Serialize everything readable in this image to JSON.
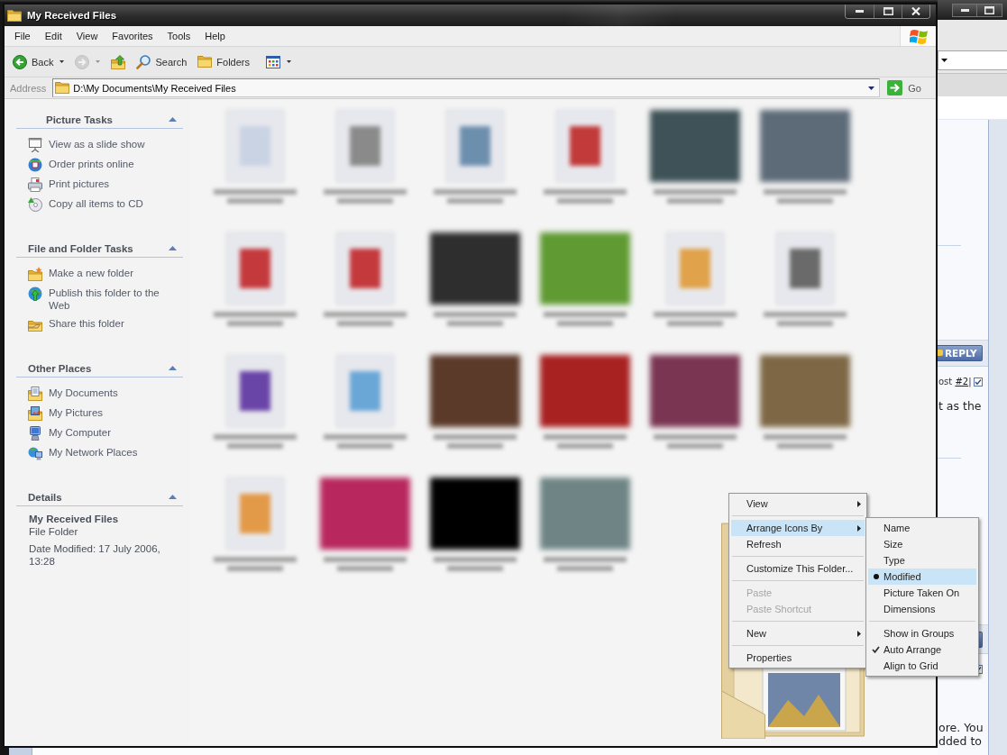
{
  "background_window": {
    "window_controls": [
      {
        "kind": "minimize"
      },
      {
        "kind": "maximize"
      }
    ]
  },
  "forum": {
    "posts": [
      {
        "reply_label": "REPLY",
        "post_text": "ost",
        "post_link": "#2",
        "post_separator": "|",
        "checked": true,
        "lines": [
          "t as the"
        ]
      },
      {
        "checked": true,
        "lines": [
          "ore. You",
          "dded to"
        ]
      }
    ]
  },
  "explorer": {
    "title": "My Received Files",
    "window_controls": [
      {
        "kind": "minimize"
      },
      {
        "kind": "maximize"
      },
      {
        "kind": "close"
      }
    ],
    "menu_bar": [
      {
        "label": "File"
      },
      {
        "label": "Edit"
      },
      {
        "label": "View"
      },
      {
        "label": "Favorites"
      },
      {
        "label": "Tools"
      },
      {
        "label": "Help"
      }
    ],
    "toolbar": [
      {
        "kind": "back",
        "label": "Back",
        "dropdown": true,
        "disabled": false
      },
      {
        "kind": "forward",
        "dropdown": true,
        "disabled": true
      },
      {
        "kind": "up",
        "dropdown": false,
        "disabled": false
      },
      {
        "kind": "search",
        "label": "Search",
        "dropdown": false,
        "disabled": false
      },
      {
        "kind": "folders",
        "label": "Folders",
        "dropdown": false,
        "disabled": false
      },
      {
        "kind": "views",
        "dropdown": true,
        "disabled": false
      }
    ],
    "address": {
      "label": "Address",
      "value": "D:\\My Documents\\My Received Files",
      "go_label": "Go"
    },
    "task_panes": [
      {
        "title": "Picture Tasks",
        "kind": "special",
        "expanded": true,
        "items": [
          {
            "kind": "slideshow",
            "label": "View as a slide show"
          },
          {
            "kind": "prints",
            "label": "Order prints online"
          },
          {
            "kind": "print",
            "label": "Print pictures"
          },
          {
            "kind": "cd",
            "label": "Copy all items to CD"
          }
        ]
      },
      {
        "title": "File and Folder Tasks",
        "kind": "normal",
        "expanded": true,
        "items": [
          {
            "kind": "new_folder",
            "label": "Make a new folder"
          },
          {
            "kind": "publish",
            "label": "Publish this folder to the Web"
          },
          {
            "kind": "share",
            "label": "Share this folder"
          }
        ]
      },
      {
        "title": "Other Places",
        "kind": "normal",
        "expanded": true,
        "items": [
          {
            "kind": "documents",
            "label": "My Documents"
          },
          {
            "kind": "pictures",
            "label": "My Pictures"
          },
          {
            "kind": "computer",
            "label": "My Computer"
          },
          {
            "kind": "network",
            "label": "My Network Places"
          }
        ]
      }
    ],
    "details": {
      "title": "Details",
      "expanded": true,
      "name": "My Received Files",
      "type": "File Folder",
      "modified": "Date Modified: 17 July 2006, 13:28"
    },
    "files": [
      {
        "kind": "document",
        "color": "#c9d3e3"
      },
      {
        "kind": "document",
        "color": "#8a8a8a"
      },
      {
        "kind": "document",
        "color": "#6d8fae"
      },
      {
        "kind": "document",
        "color": "#c23a3a"
      },
      {
        "kind": "photo",
        "color": "#3f5257"
      },
      {
        "kind": "photo",
        "color": "#5d6b78"
      },
      {
        "kind": "document",
        "color": "#c4393c"
      },
      {
        "kind": "document",
        "color": "#c4393c"
      },
      {
        "kind": "photo",
        "color": "#2e2e2e"
      },
      {
        "kind": "photo",
        "color": "#5f9a32"
      },
      {
        "kind": "document",
        "color": "#e0a24a"
      },
      {
        "kind": "document",
        "color": "#6a6a6a"
      },
      {
        "kind": "document",
        "color": "#6a45a8"
      },
      {
        "kind": "document",
        "color": "#6aa6d6"
      },
      {
        "kind": "photo",
        "color": "#5b3a2a"
      },
      {
        "kind": "photo",
        "color": "#a82222"
      },
      {
        "kind": "photo",
        "color": "#7a3552"
      },
      {
        "kind": "photo",
        "color": "#7d6745"
      },
      {
        "kind": "document",
        "color": "#e39a48"
      },
      {
        "kind": "photo",
        "color": "#b8285e"
      },
      {
        "kind": "photo",
        "color": "#000000"
      },
      {
        "kind": "photo",
        "color": "#6f8585"
      }
    ],
    "context_menu": {
      "groups": [
        [
          {
            "label": "View",
            "submenu": true,
            "highlighted": false,
            "disabled": false
          }
        ],
        [
          {
            "label": "Arrange Icons By",
            "submenu": true,
            "highlighted": true,
            "disabled": false,
            "open_submenu": {
              "groups": [
                [
                  {
                    "label": "Name",
                    "kind": "radio",
                    "checked": false,
                    "highlighted": false
                  },
                  {
                    "label": "Size",
                    "kind": "radio",
                    "checked": false,
                    "highlighted": false
                  },
                  {
                    "label": "Type",
                    "kind": "radio",
                    "checked": false,
                    "highlighted": false
                  },
                  {
                    "label": "Modified",
                    "kind": "radio",
                    "checked": true,
                    "highlighted": true
                  },
                  {
                    "label": "Picture Taken On",
                    "kind": "radio",
                    "checked": false,
                    "highlighted": false
                  },
                  {
                    "label": "Dimensions",
                    "kind": "radio",
                    "checked": false,
                    "highlighted": false
                  }
                ],
                [
                  {
                    "label": "Show in Groups",
                    "kind": "check",
                    "checked": false,
                    "highlighted": false
                  },
                  {
                    "label": "Auto Arrange",
                    "kind": "check",
                    "checked": true,
                    "highlighted": false
                  },
                  {
                    "label": "Align to Grid",
                    "kind": "check",
                    "checked": false,
                    "highlighted": false
                  }
                ]
              ]
            }
          },
          {
            "label": "Refresh",
            "submenu": false,
            "highlighted": false,
            "disabled": false
          }
        ],
        [
          {
            "label": "Customize This Folder...",
            "submenu": false,
            "highlighted": false,
            "disabled": false
          }
        ],
        [
          {
            "label": "Paste",
            "submenu": false,
            "highlighted": false,
            "disabled": true
          },
          {
            "label": "Paste Shortcut",
            "submenu": false,
            "highlighted": false,
            "disabled": true
          }
        ],
        [
          {
            "label": "New",
            "submenu": true,
            "highlighted": false,
            "disabled": false
          }
        ],
        [
          {
            "label": "Properties",
            "submenu": false,
            "highlighted": false,
            "disabled": false
          }
        ]
      ]
    }
  }
}
